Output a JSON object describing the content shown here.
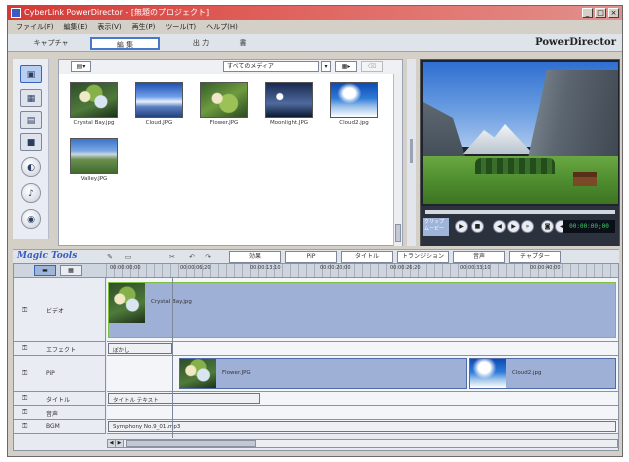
{
  "window": {
    "title": "CyberLink PowerDirector - [無題のプロジェクト]",
    "controls": [
      "_",
      "□",
      "×"
    ]
  },
  "menu": [
    "ファイル(F)",
    "編集(E)",
    "表示(V)",
    "再生(P)",
    "ツール(T)",
    "ヘルプ(H)"
  ],
  "modes": [
    {
      "label": "キャプチャ",
      "active": false
    },
    {
      "label": "編 集",
      "active": true
    },
    {
      "label": "出 力",
      "active": false
    },
    {
      "label": "書",
      "active": false
    }
  ],
  "brand": "PowerDirector",
  "library": {
    "filter": "すべてのメディア",
    "items": [
      {
        "caption": "Crystal Bay.jpg",
        "image": "flowers"
      },
      {
        "caption": "Cloud.JPG",
        "image": "lake"
      },
      {
        "caption": "Flower.JPG",
        "image": "green"
      },
      {
        "caption": "Moonlight.JPG",
        "image": "night"
      },
      {
        "caption": "Cloud2.jpg",
        "image": "sky"
      },
      {
        "caption": "Valley.JPG",
        "image": "valley"
      }
    ]
  },
  "preview": {
    "mode_label": "クリップ ムービー",
    "timecode": "00:00:00;00"
  },
  "magic": {
    "label": "Magic Tools",
    "tabs": [
      "効果",
      "PiP",
      "タイトル",
      "トランジション",
      "音声",
      "チャプター"
    ]
  },
  "timeline": {
    "ruler": [
      "00:00:00;00",
      "00:00:06;20",
      "00:00:13;10",
      "00:00:20;00",
      "00:00:26;20",
      "00:00:33;10",
      "00:00:40;00"
    ],
    "tracks": [
      {
        "name": "ビデオ",
        "clips": [
          {
            "label": "Crystal Bay.jpg",
            "image": "flowers"
          }
        ]
      },
      {
        "name": "エフェクト",
        "clips": [
          {
            "label": "ぼかし"
          }
        ]
      },
      {
        "name": "PiP",
        "clips": [
          {
            "label": "Flower.JPG",
            "image": "flowers"
          },
          {
            "label": "Cloud2.jpg",
            "image": "sky"
          }
        ]
      },
      {
        "name": "タイトル",
        "clips": [
          {
            "label": "タイトル テキスト"
          }
        ]
      },
      {
        "name": "音声",
        "clips": []
      },
      {
        "name": "BGM",
        "clips": [
          {
            "label": "Symphony No.9_01.mp3"
          }
        ]
      }
    ]
  }
}
